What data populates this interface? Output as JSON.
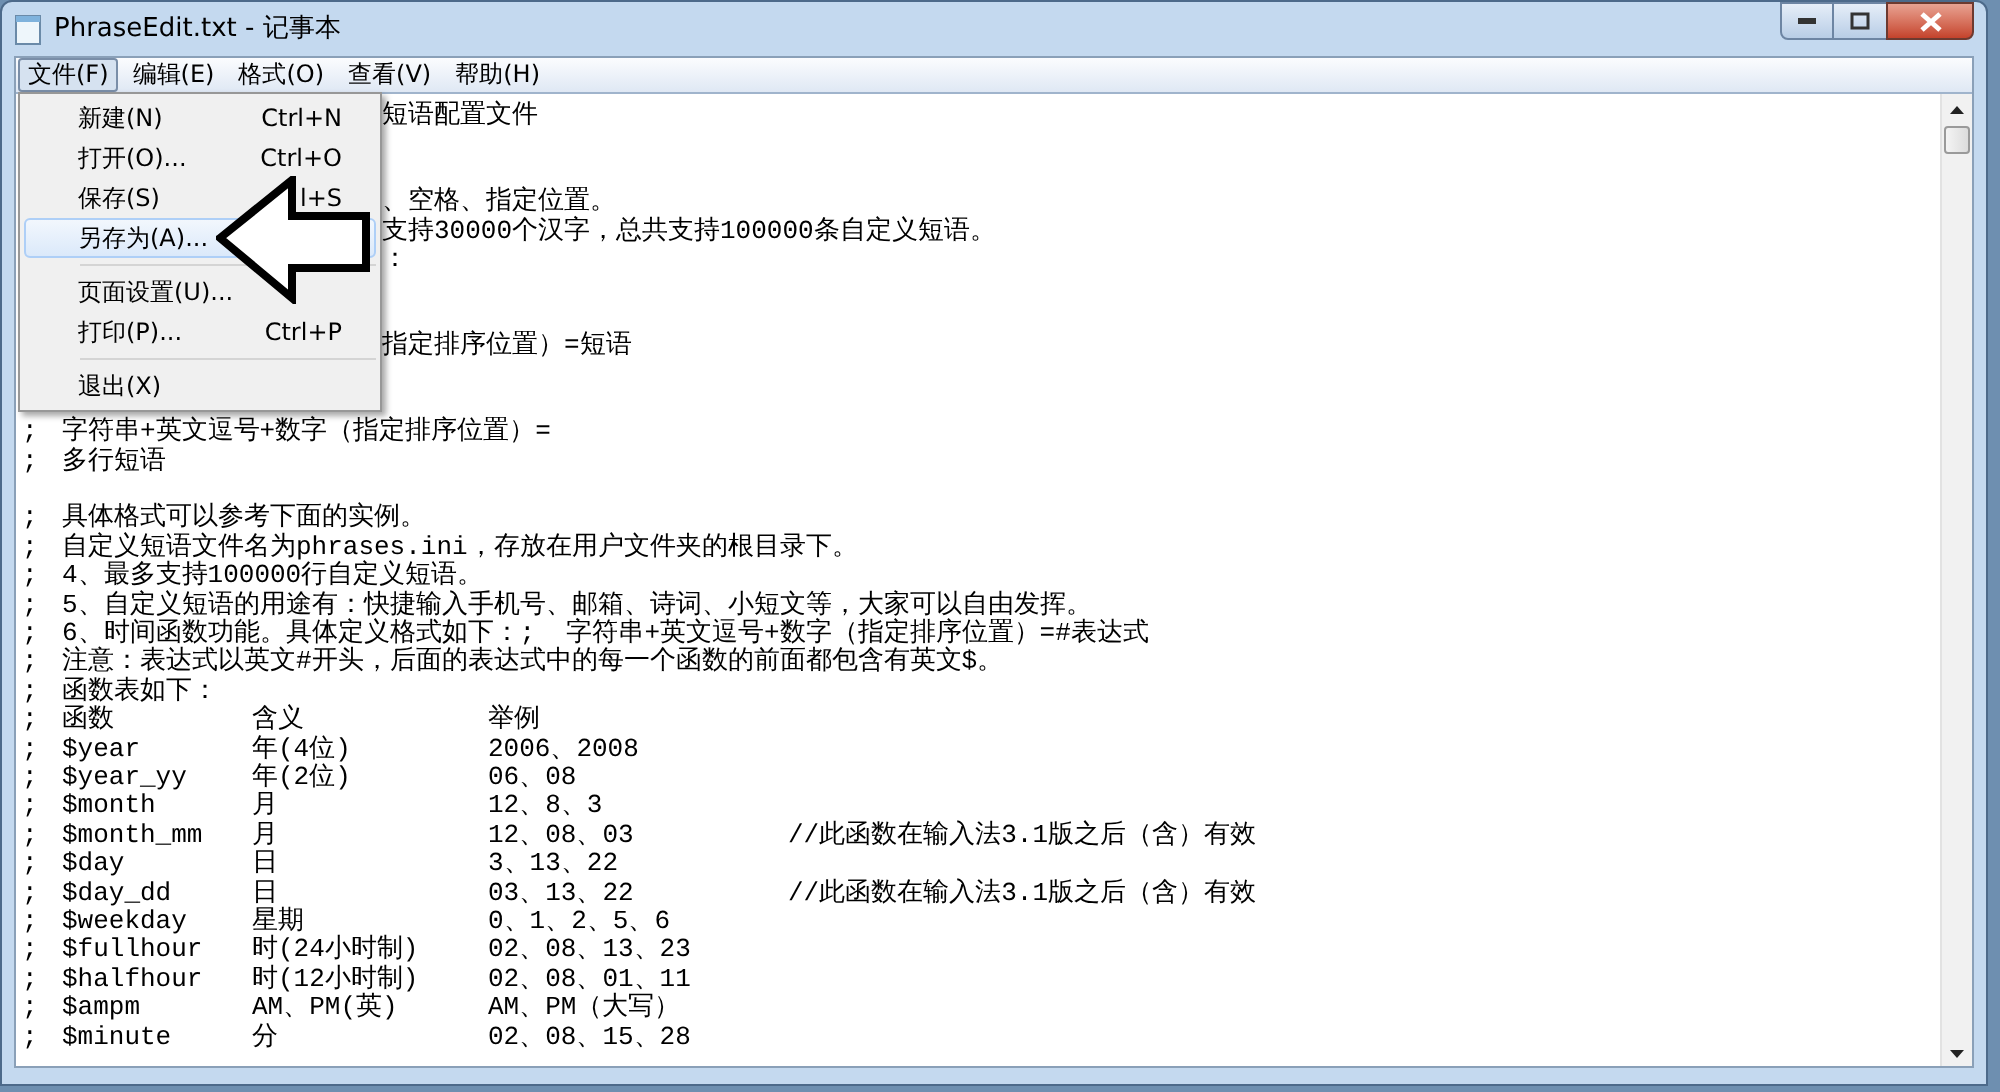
{
  "window": {
    "title": "PhraseEdit.txt - 记事本"
  },
  "menu_bar": [
    {
      "label": "文件(F)",
      "selected": true
    },
    {
      "label": "编辑(E)",
      "selected": false
    },
    {
      "label": "格式(O)",
      "selected": false
    },
    {
      "label": "查看(V)",
      "selected": false
    },
    {
      "label": "帮助(H)",
      "selected": false
    }
  ],
  "file_menu": [
    {
      "kind": "item",
      "label": "新建(N)",
      "shortcut": "Ctrl+N",
      "selected": false
    },
    {
      "kind": "item",
      "label": "打开(O)...",
      "shortcut": "Ctrl+O",
      "selected": false
    },
    {
      "kind": "item",
      "label": "保存(S)",
      "shortcut": "l+S",
      "selected": false
    },
    {
      "kind": "item",
      "label": "另存为(A)...",
      "selected": true
    },
    {
      "kind": "separator"
    },
    {
      "kind": "item",
      "label": "页面设置(U)...",
      "selected": false
    },
    {
      "kind": "item",
      "label": "打印(P)...",
      "shortcut": "Ctrl+P",
      "selected": false
    },
    {
      "kind": "separator"
    },
    {
      "kind": "item",
      "label": "退出(X)",
      "selected": false
    }
  ],
  "editor_lines": [
    {
      "kind": "covered",
      "text": "短语配置文件"
    },
    {
      "kind": "blank"
    },
    {
      "kind": "blank"
    },
    {
      "kind": "covered",
      "text": "、空格、指定位置。"
    },
    {
      "kind": "covered",
      "text": "支持30000个汉字，总共支持100000条自定义短语。"
    },
    {
      "kind": "covered",
      "text": "："
    },
    {
      "kind": "blank"
    },
    {
      "kind": "blank"
    },
    {
      "kind": "covered",
      "text": "指定排序位置）=短语"
    },
    {
      "kind": "blank"
    },
    {
      "kind": "blank"
    },
    {
      "kind": "line",
      "text": "字符串+英文逗号+数字（指定排序位置）="
    },
    {
      "kind": "line",
      "text": "多行短语"
    },
    {
      "kind": "blank"
    },
    {
      "kind": "line",
      "text": "具体格式可以参考下面的实例。"
    },
    {
      "kind": "line",
      "text": "自定义短语文件名为phrases.ini，存放在用户文件夹的根目录下。"
    },
    {
      "kind": "line",
      "text": "4、最多支持100000行自定义短语。"
    },
    {
      "kind": "line",
      "text": "5、自定义短语的用途有：快捷输入手机号、邮箱、诗词、小短文等，大家可以自由发挥。"
    },
    {
      "kind": "line",
      "text": "6、时间函数功能。具体定义格式如下：;  字符串+英文逗号+数字（指定排序位置）=#表达式"
    },
    {
      "kind": "line",
      "text": "注意：表达式以英文#开头，后面的表达式中的每一个函数的前面都包含有英文$。"
    },
    {
      "kind": "line",
      "text": "函数表如下："
    },
    {
      "kind": "row",
      "cells": [
        "函数",
        "含义",
        "举例"
      ]
    },
    {
      "kind": "row",
      "cells": [
        "$year",
        "年(4位)",
        "2006、2008"
      ]
    },
    {
      "kind": "row",
      "cells": [
        "$year_yy",
        "年(2位)",
        "06、08"
      ]
    },
    {
      "kind": "row",
      "cells": [
        "$month",
        "月",
        "12、8、3"
      ]
    },
    {
      "kind": "row",
      "cells": [
        "$month_mm",
        "月",
        "12、08、03",
        "//此函数在输入法3.1版之后（含）有效"
      ]
    },
    {
      "kind": "row",
      "cells": [
        "$day",
        "日",
        "3、13、22"
      ]
    },
    {
      "kind": "row",
      "cells": [
        "$day_dd",
        "日",
        "03、13、22",
        "//此函数在输入法3.1版之后（含）有效"
      ]
    },
    {
      "kind": "row",
      "cells": [
        "$weekday",
        "星期",
        "0、1、2、5、6"
      ]
    },
    {
      "kind": "row",
      "cells": [
        "$fullhour",
        "时(24小时制)",
        "02、08、13、23"
      ]
    },
    {
      "kind": "row",
      "cells": [
        "$halfhour",
        "时(12小时制)",
        "02、08、01、11"
      ]
    },
    {
      "kind": "row",
      "cells": [
        "$ampm",
        "AM、PM(英)",
        "AM、PM（大写）"
      ]
    },
    {
      "kind": "row",
      "cells": [
        "$minute",
        "分",
        "02、08、15、28"
      ]
    }
  ],
  "line_prefix": ";"
}
